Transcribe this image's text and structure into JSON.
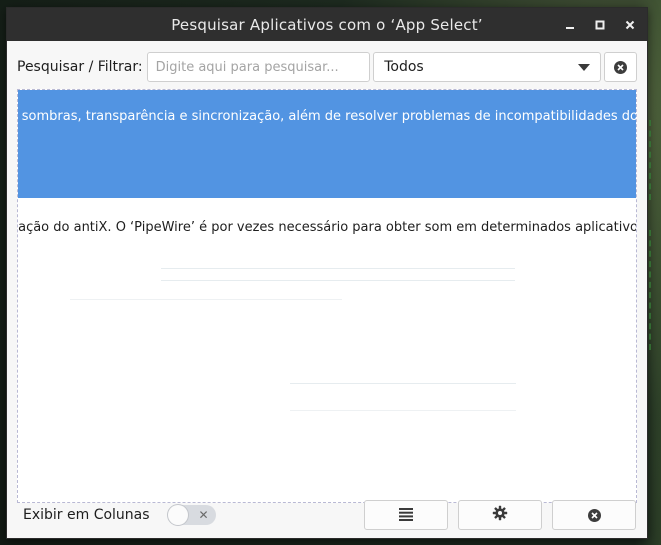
{
  "window": {
    "title": "Pesquisar Aplicativos com o ‘App Select’",
    "controls": [
      "minimize-icon",
      "maximize-icon",
      "close-icon"
    ]
  },
  "toolbar": {
    "search_label": "Pesquisar / Filtrar:",
    "search_placeholder": "Digite aqui para pesquisar...",
    "search_value": "",
    "filter_selected": "Todos",
    "clear_icon": "clear-circle-x-icon"
  },
  "list": {
    "items": [
      {
        "text": "pição, sombras, transparência e sincronização, além de resolver problemas de incompatibilidades do",
        "selected": true
      },
      {
        "text": "cialização do antiX. O ‘PipeWire’ é por vezes necessário para obter som em determinados aplicativo",
        "selected": false
      }
    ]
  },
  "bottom": {
    "columns_label": "Exibir em Colunas",
    "columns_toggle_on": false,
    "buttons": [
      "list-icon",
      "gear-icon",
      "close-circle-icon"
    ]
  },
  "colors": {
    "titlebar": "#2f2f2f",
    "selection": "#5294e2",
    "window_bg": "#f7f7f7"
  }
}
